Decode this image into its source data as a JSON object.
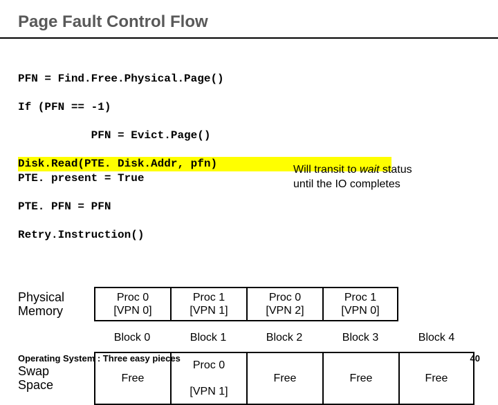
{
  "title": "Page Fault Control Flow",
  "code": {
    "l1": "PFN = Find.Free.Physical.Page()",
    "l2": "If (PFN == -1)",
    "l3": "           PFN = Evict.Page()",
    "l4": "Disk.Read(PTE. Disk.Addr, pfn)",
    "l5": "PTE. present = True",
    "l6": "PTE. PFN = PFN",
    "l7": "Retry.Instruction()"
  },
  "annotation": {
    "line": "Will transit to wait status until the IO completes",
    "wait_word": "wait"
  },
  "phys_label": "Physical Memory",
  "phys_cells": [
    {
      "l1": "Proc 0",
      "l2": "[VPN 0]"
    },
    {
      "l1": "Proc 1",
      "l2": "[VPN 1]"
    },
    {
      "l1": "Proc 0",
      "l2": "[VPN 2]"
    },
    {
      "l1": "Proc 1",
      "l2": "[VPN 0]"
    }
  ],
  "block_headers": [
    "Block 0",
    "Block 1",
    "Block 2",
    "Block 3",
    "Block 4"
  ],
  "swap_label": "Swap Space",
  "swap_cells": [
    {
      "l1": "Free",
      "l2": ""
    },
    {
      "l1": "Proc 0",
      "l2": "[VPN 1]"
    },
    {
      "l1": "Free",
      "l2": ""
    },
    {
      "l1": "Free",
      "l2": ""
    },
    {
      "l1": "Free",
      "l2": ""
    }
  ],
  "footer": {
    "left": "Operating System : Three easy pieces",
    "pageno": "40"
  }
}
